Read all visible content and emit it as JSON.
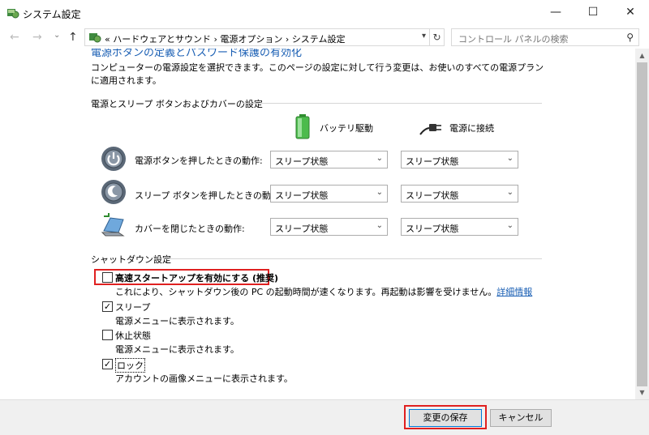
{
  "window": {
    "title": "システム設定",
    "minimize": "—",
    "maximize": "☐",
    "close": "✕"
  },
  "nav": {
    "back": "←",
    "forward": "→",
    "recent": "⌄",
    "up": "↑",
    "breadcrumb": "« ハードウェアとサウンド › 電源オプション › システム設定",
    "refresh": "↻",
    "search_placeholder": "コントロール パネルの検索"
  },
  "content": {
    "partial_heading": "電源ボタンの定義とパスワード保護の有効化",
    "description": "コンピューターの電源設定を選択できます。このページの設定に対して行う変更は、お使いのすべての電源プランに適用されます。",
    "power_group": {
      "heading": "電源とスリープ ボタンおよびカバーの設定",
      "col_battery": "バッテリ駆動",
      "col_plugged": "電源に接続",
      "rows": [
        {
          "label": "電源ボタンを押したときの動作:",
          "battery": "スリープ状態",
          "plugged": "スリープ状態",
          "icon": "power-button-icon"
        },
        {
          "label": "スリープ ボタンを押したときの動作:",
          "battery": "スリープ状態",
          "plugged": "スリープ状態",
          "icon": "sleep-button-icon"
        },
        {
          "label": "カバーを閉じたときの動作:",
          "battery": "スリープ状態",
          "plugged": "スリープ状態",
          "icon": "laptop-lid-icon"
        }
      ]
    },
    "shutdown_group": {
      "heading": "シャットダウン設定",
      "items": [
        {
          "label": "高速スタートアップを有効にする (推奨)",
          "checked": false,
          "desc": "これにより、シャットダウン後の PC の起動時間が速くなります。再起動は影響を受けません。",
          "link": "詳細情報"
        },
        {
          "label": "スリープ",
          "checked": true,
          "desc": "電源メニューに表示されます。"
        },
        {
          "label": "休止状態",
          "checked": false,
          "desc": "電源メニューに表示されます。"
        },
        {
          "label": "ロック",
          "checked": true,
          "desc": "アカウントの画像メニューに表示されます。"
        }
      ]
    }
  },
  "footer": {
    "save": "変更の保存",
    "cancel": "キャンセル"
  },
  "colors": {
    "highlight": "#e02020",
    "link": "#1a5fb4"
  }
}
